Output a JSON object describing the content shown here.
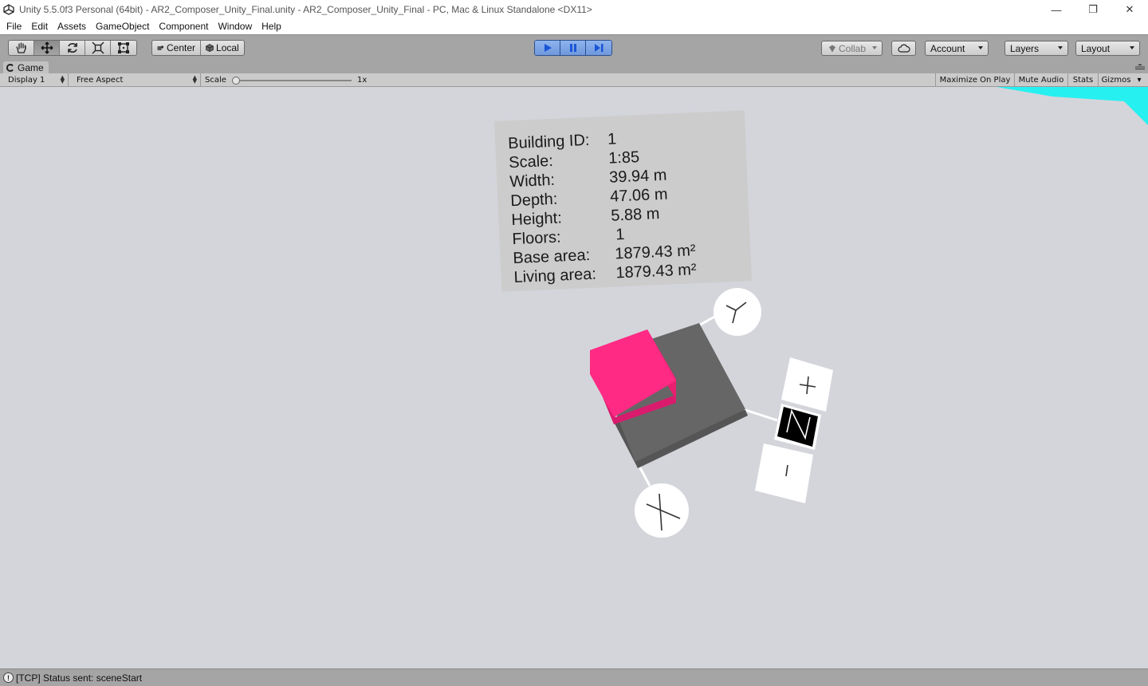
{
  "window": {
    "title": "Unity 5.5.0f3 Personal (64bit) - AR2_Composer_Unity_Final.unity - AR2_Composer_Unity_Final - PC, Mac & Linux Standalone <DX11>",
    "minimize_glyph": "—",
    "restore_glyph": "❐",
    "close_glyph": "✕"
  },
  "menu": [
    "File",
    "Edit",
    "Assets",
    "GameObject",
    "Component",
    "Window",
    "Help"
  ],
  "toolbar": {
    "tools": [
      {
        "name": "hand-tool",
        "icon": "hand-icon"
      },
      {
        "name": "move-tool",
        "icon": "move-icon",
        "active": true
      },
      {
        "name": "rotate-tool",
        "icon": "rotate-icon"
      },
      {
        "name": "scale-tool",
        "icon": "scale-icon"
      },
      {
        "name": "rect-tool",
        "icon": "rect-icon"
      }
    ],
    "pivot_label": "Center",
    "space_label": "Local",
    "collab_label": "Collab",
    "account_label": "Account",
    "layers_label": "Layers",
    "layout_label": "Layout",
    "play_color": "#1a55d6"
  },
  "game_view": {
    "tab_label": "Game",
    "display": "Display 1",
    "aspect": "Free Aspect",
    "scale_label": "Scale",
    "scale_value": "1x",
    "scale_level": 0.0,
    "toggles": [
      "Maximize On Play",
      "Mute Audio",
      "Stats",
      "Gizmos"
    ]
  },
  "scene": {
    "background": "#d4d5db",
    "building_color": "#ff2a84",
    "base_color": "#666666",
    "compass": {
      "plus": "+",
      "north": "N",
      "minus": "-"
    },
    "info": [
      {
        "label": "Building ID:",
        "value": "1"
      },
      {
        "label": "Scale:",
        "value": "1:85"
      },
      {
        "label": "Width:",
        "value": "39.94 m"
      },
      {
        "label": "Depth:",
        "value": "47.06 m"
      },
      {
        "label": "Height:",
        "value": "5.88 m"
      },
      {
        "label": "Floors:",
        "value": "1"
      },
      {
        "label": "Base area:",
        "value": "1879.43 m²"
      },
      {
        "label": "Living area:",
        "value": "1879.43 m²"
      }
    ]
  },
  "status": {
    "icon_glyph": "!",
    "message": "[TCP] Status sent: sceneStart"
  }
}
